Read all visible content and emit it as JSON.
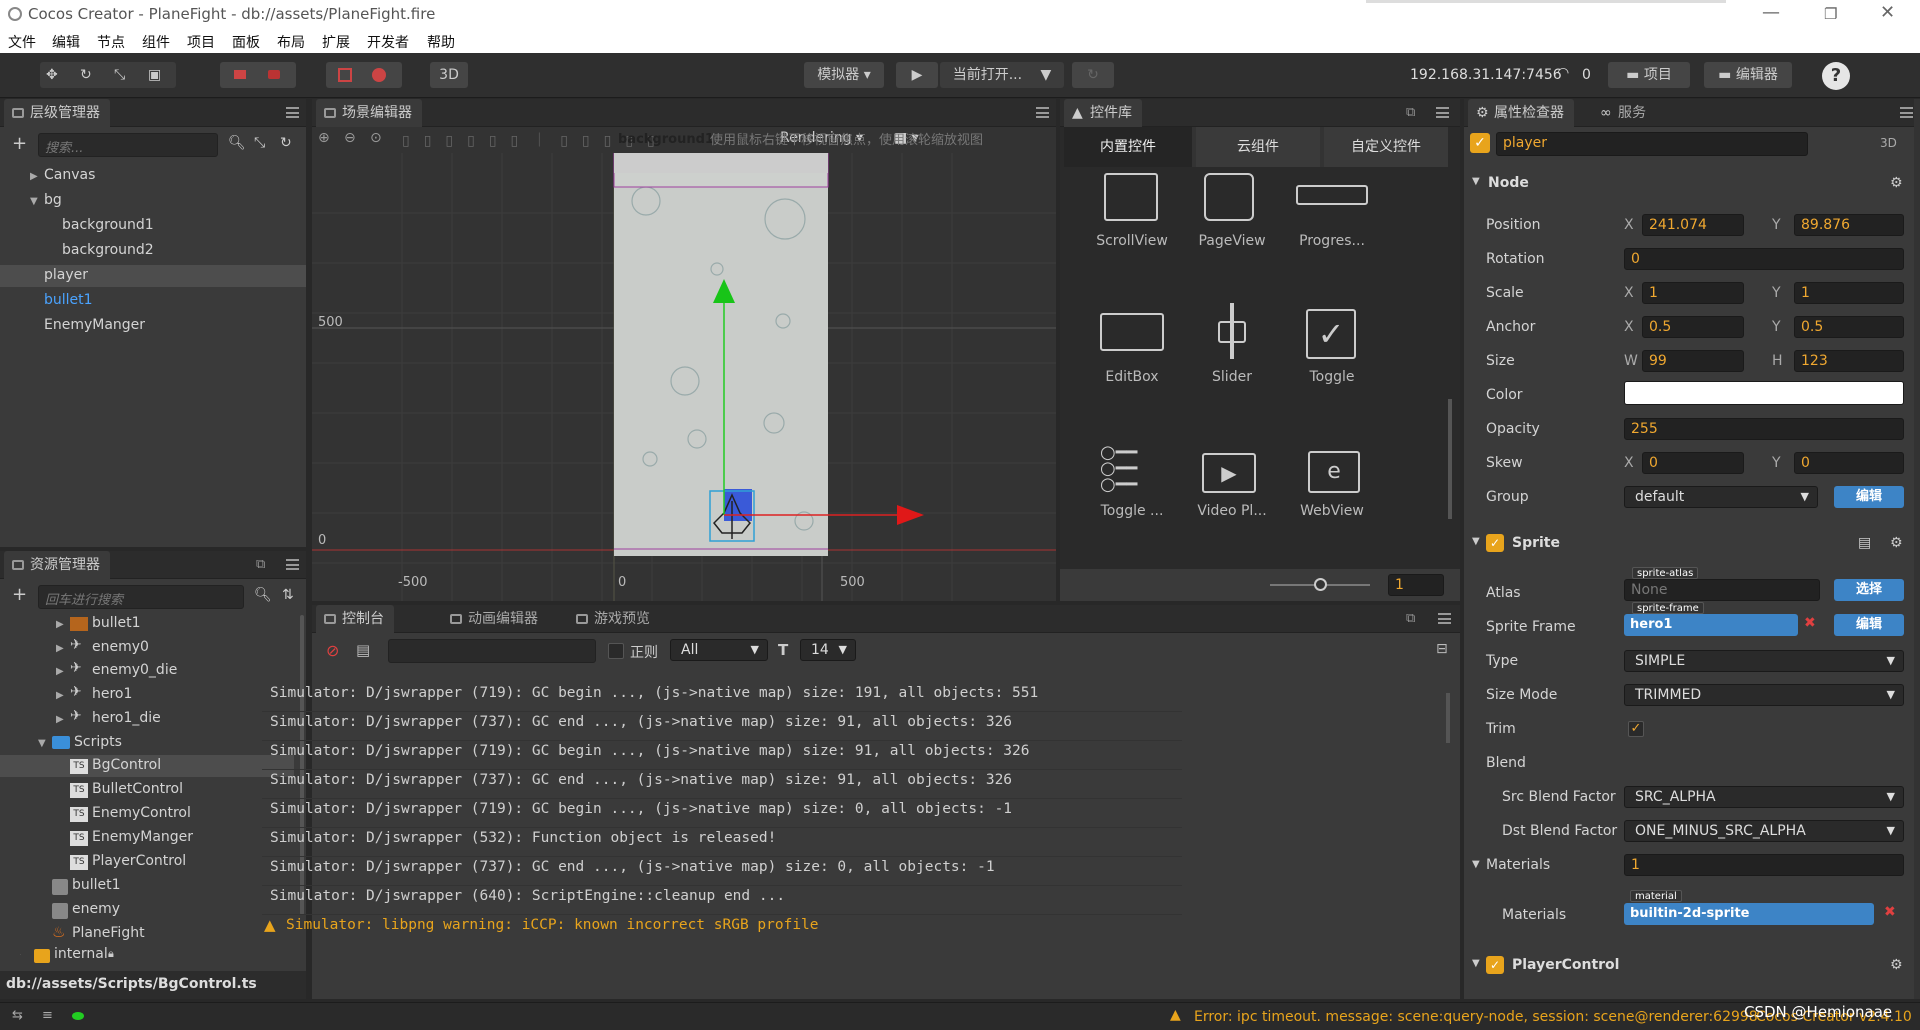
{
  "window": {
    "title": "Cocos Creator - PlaneFight - db://assets/PlaneFight.fire"
  },
  "menu": [
    "文件",
    "编辑",
    "节点",
    "组件",
    "项目",
    "面板",
    "布局",
    "扩展",
    "开发者",
    "帮助"
  ],
  "toolbar": {
    "preview_mode": "模拟器",
    "current_open": "当前打开...",
    "mode_3d": "3D",
    "ip": "192.168.31.147:7456",
    "conn_count": "0",
    "project_btn": "项目",
    "editor_btn": "编辑器",
    "help": "?"
  },
  "hierarchy": {
    "tab": "层级管理器",
    "search_placeholder": "搜索...",
    "items": [
      "Canvas",
      "bg",
      "background1",
      "background2",
      "player",
      "bullet1",
      "EnemyManger"
    ]
  },
  "assets": {
    "tab": "资源管理器",
    "search_placeholder": "回车进行搜索",
    "items": [
      "bullet1",
      "enemy0",
      "enemy0_die",
      "hero1",
      "hero1_die",
      "Scripts",
      "BgControl",
      "BulletControl",
      "EnemyControl",
      "EnemyManger",
      "PlayerControl",
      "bullet1",
      "enemy",
      "PlaneFight",
      "internal"
    ],
    "path": "db://assets/Scripts/BgControl.ts"
  },
  "scene": {
    "tab": "场景编辑器",
    "rendering": "Rendering",
    "hint": "使用鼠标右键平移视窗焦点，使用滚轮缩放视图",
    "node_label": "background1",
    "y_labels": [
      "500",
      "0"
    ],
    "x_labels": [
      "-500",
      "0",
      "500"
    ]
  },
  "widgets": {
    "tab": "控件库",
    "subtabs": [
      "内置控件",
      "云组件",
      "自定义控件"
    ],
    "items": [
      "ScrollView",
      "PageView",
      "Progres...",
      "EditBox",
      "Slider",
      "Toggle",
      "Toggle ...",
      "Video Pl...",
      "WebView"
    ],
    "zoom": "1"
  },
  "console": {
    "tabs": [
      "控制台",
      "动画编辑器",
      "游戏预览"
    ],
    "regex": "正则",
    "level": "All",
    "font_size": "14",
    "lines": [
      "Simulator: D/jswrapper (719): GC begin ..., (js->native map) size: 191, all objects: 551",
      "Simulator: D/jswrapper (737): GC end ..., (js->native map) size: 91, all objects: 326",
      "Simulator: D/jswrapper (719): GC begin ..., (js->native map) size: 91, all objects: 326",
      "Simulator: D/jswrapper (737): GC end ..., (js->native map) size: 91, all objects: 326",
      "Simulator: D/jswrapper (719): GC begin ..., (js->native map) size: 0, all objects: -1",
      "Simulator: D/jswrapper (532): Function object is released!",
      "Simulator: D/jswrapper (737): GC end ..., (js->native map) size: 0, all objects: -1",
      "Simulator: D/jswrapper (640): ScriptEngine::cleanup end ..."
    ],
    "warning": "Simulator: libpng warning: iCCP: known incorrect sRGB profile"
  },
  "inspector": {
    "tab": "属性检查器",
    "tab2": "服务",
    "node_name": "player",
    "mode": "3D",
    "node": {
      "title": "Node",
      "position_x": "241.074",
      "position_y": "89.876",
      "rotation": "0",
      "scale_x": "1",
      "scale_y": "1",
      "anchor_x": "0.5",
      "anchor_y": "0.5",
      "width": "99",
      "height": "123",
      "color": "#ffffff",
      "opacity": "255",
      "skew_x": "0",
      "skew_y": "0",
      "group": "default",
      "edit": "编辑"
    },
    "labels": {
      "position": "Position",
      "rotation": "Rotation",
      "scale": "Scale",
      "anchor": "Anchor",
      "size": "Size",
      "color": "Color",
      "opacity": "Opacity",
      "skew": "Skew",
      "group": "Group",
      "atlas": "Atlas",
      "sprite_frame": "Sprite Frame",
      "type": "Type",
      "size_mode": "Size Mode",
      "trim": "Trim",
      "blend": "Blend",
      "src": "Src Blend Factor",
      "dst": "Dst Blend Factor",
      "materials": "Materials",
      "materials2": "Materials",
      "x": "X",
      "y": "Y",
      "w": "W",
      "h": "H"
    },
    "sprite": {
      "title": "Sprite",
      "atlas_tag": "sprite-atlas",
      "atlas": "None",
      "select": "选择",
      "frame_tag": "sprite-frame",
      "frame": "hero1",
      "edit": "编辑",
      "type": "SIMPLE",
      "size_mode": "TRIMMED",
      "src_blend": "SRC_ALPHA",
      "dst_blend": "ONE_MINUS_SRC_ALPHA",
      "materials_count": "1",
      "material_tag": "material",
      "material": "builtin-2d-sprite"
    },
    "player_control": {
      "title": "PlayerControl"
    }
  },
  "status": {
    "error": "Error: ipc timeout. message: scene:query-node, session: scene@renderer:62998",
    "version": "Cocos Creator v2.4.10",
    "watermark": "CSDN @Hemionaae"
  }
}
